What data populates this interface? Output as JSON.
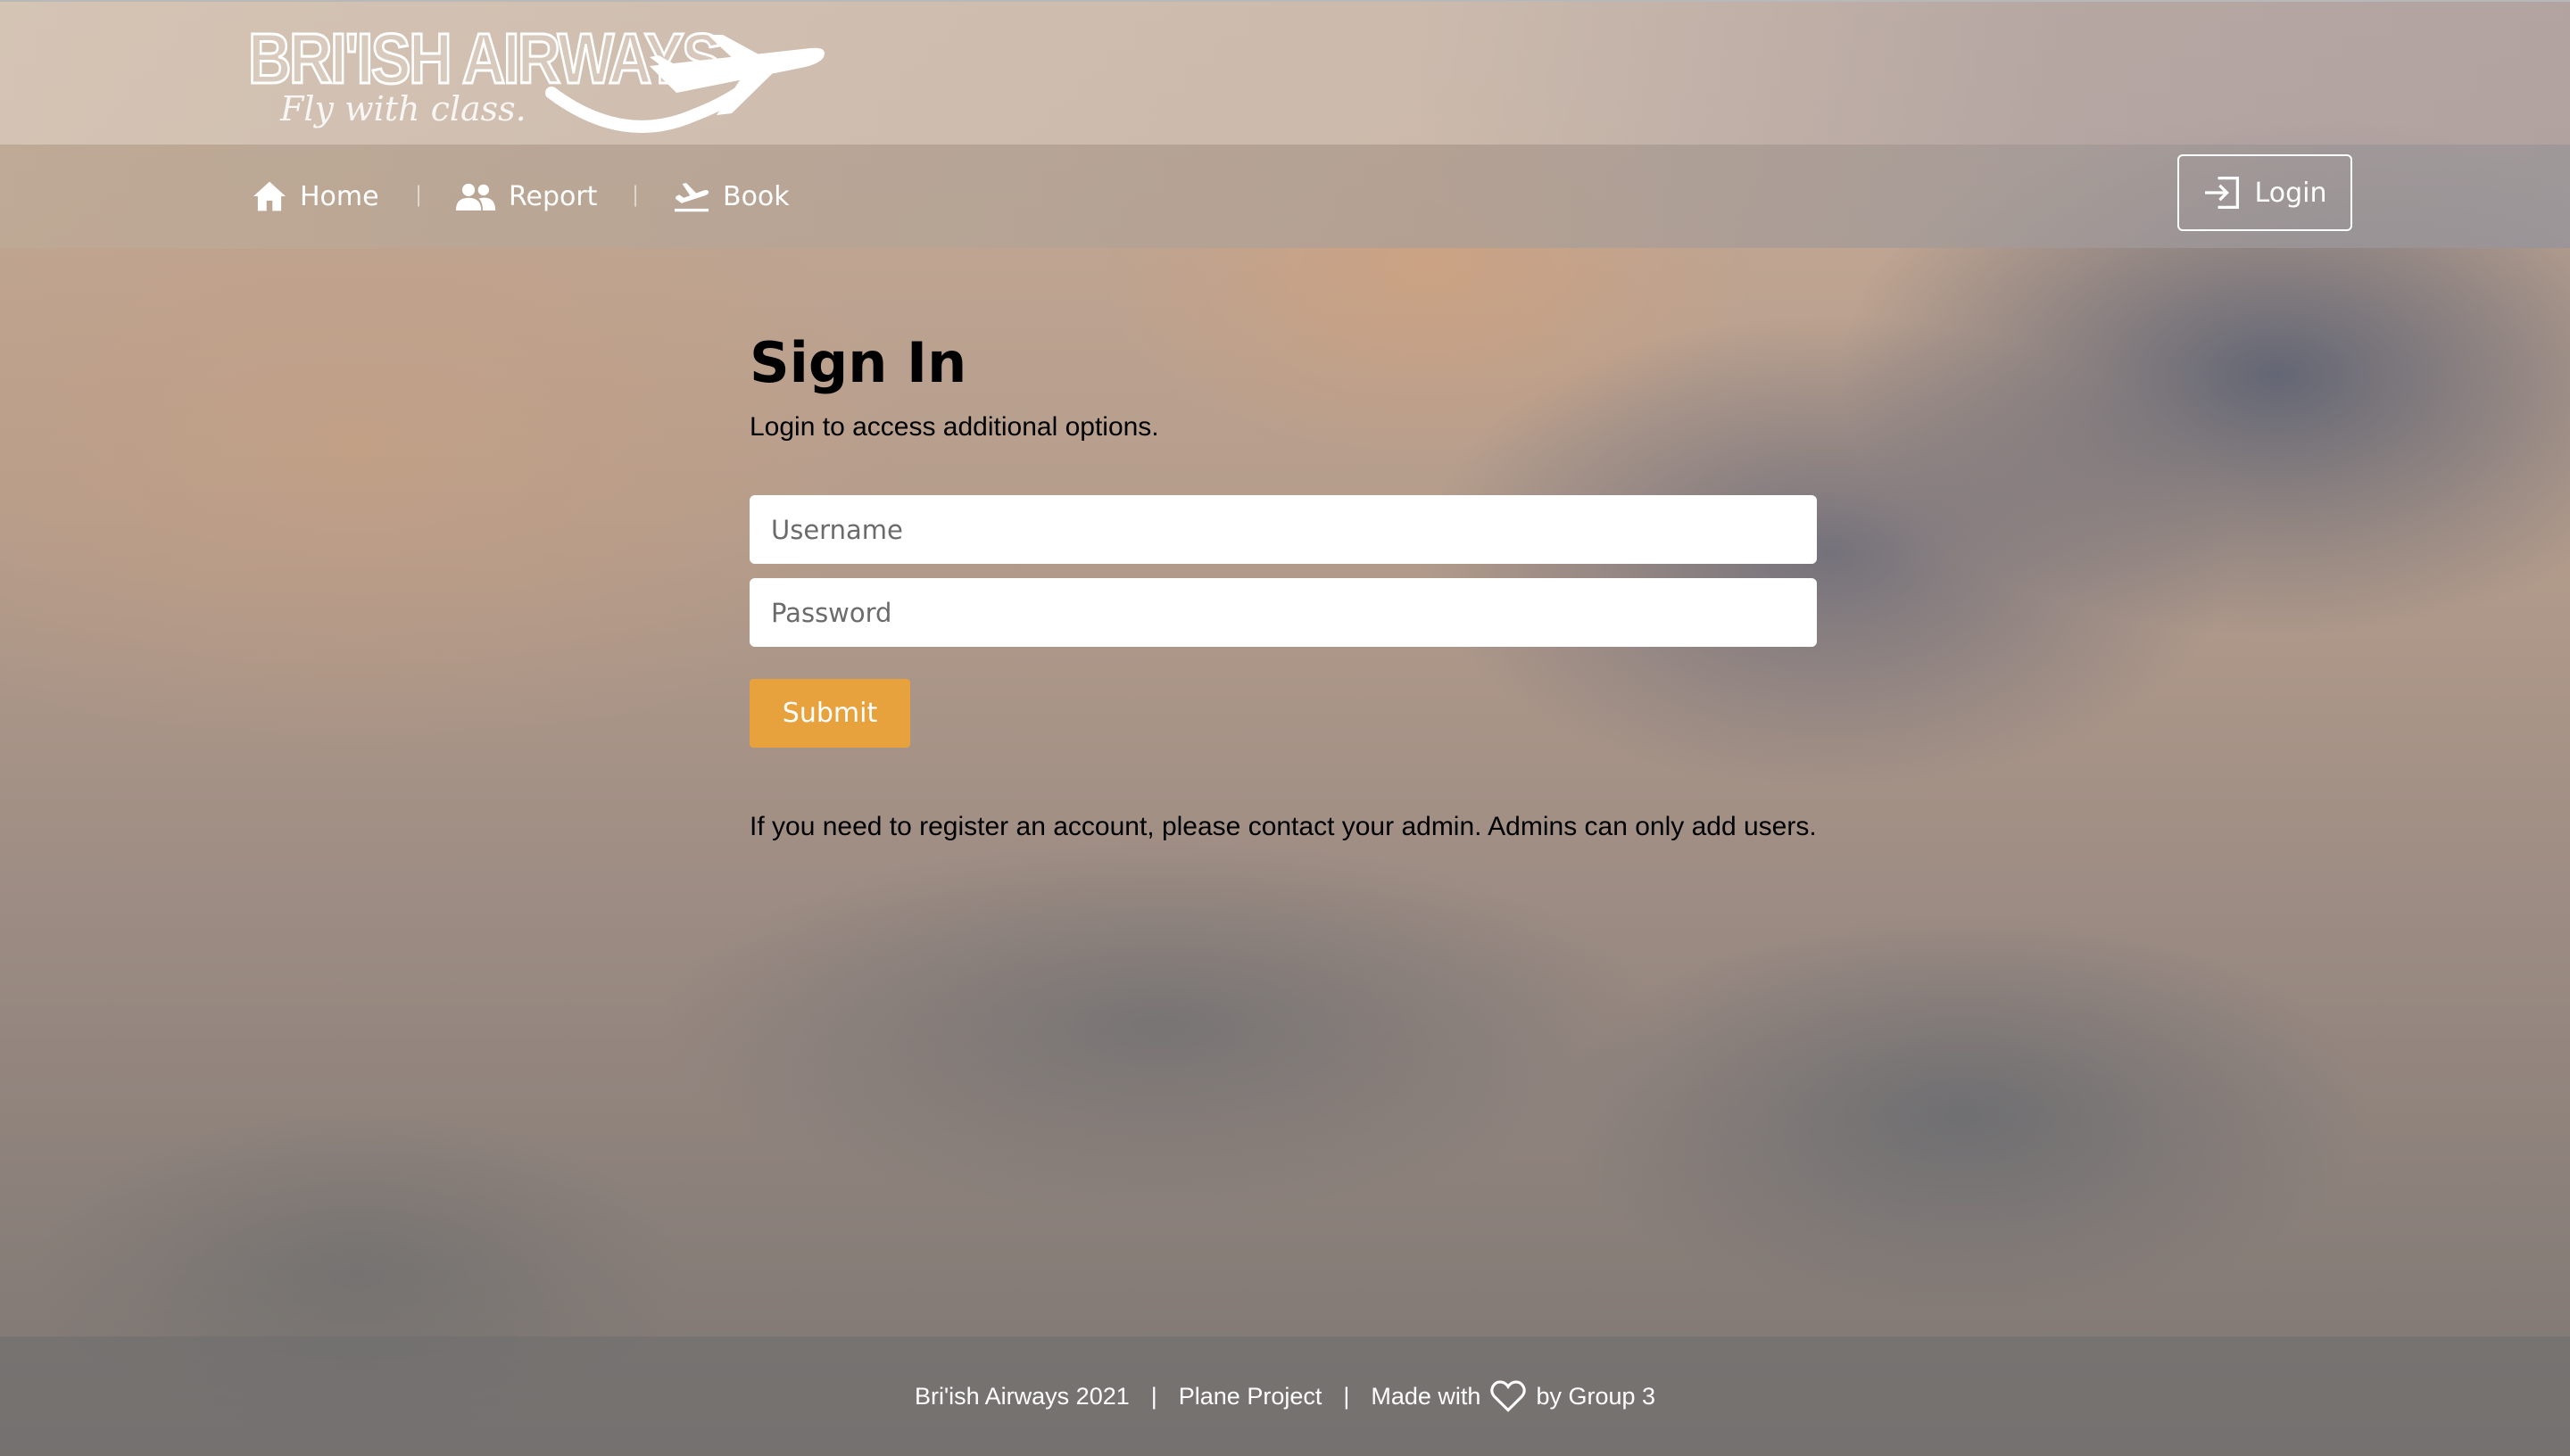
{
  "brand": {
    "name": "BRI'ISH AIRWAYS",
    "tagline": "Fly with class."
  },
  "nav": {
    "items": [
      {
        "label": "Home",
        "icon": "home-icon"
      },
      {
        "label": "Report",
        "icon": "users-icon"
      },
      {
        "label": "Book",
        "icon": "flight-takeoff-icon"
      }
    ],
    "separator": "|",
    "login_label": "Login"
  },
  "signin": {
    "title": "Sign In",
    "subtitle": "Login to access additional options.",
    "username_placeholder": "Username",
    "password_placeholder": "Password",
    "submit_label": "Submit",
    "note": "If you need to register an account, please contact your admin. Admins can only add users."
  },
  "footer": {
    "copyright": "Bri'ish Airways 2021",
    "project": "Plane Project",
    "made_with": "Made with",
    "by": "by Group 3",
    "separator": "|"
  },
  "colors": {
    "accent": "#e7a23d",
    "text": "#000000",
    "nav_text": "#ffffff"
  }
}
